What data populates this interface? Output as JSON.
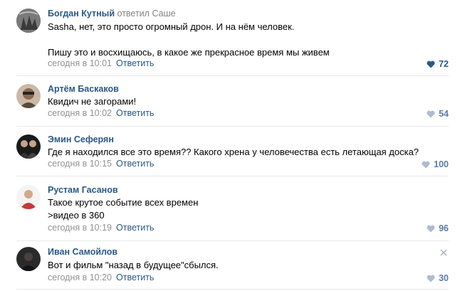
{
  "comments": [
    {
      "author": "Богдан Кутный",
      "reply_word": "ответил",
      "reply_to": "Саше",
      "text": "Sasha, нет, это просто огромный дрон. И на нём человек.\n\nПишу это и восхищаюсь, в какое же прекрасное время мы живем",
      "time": "сегодня в 10:01",
      "reply_label": "Ответить",
      "likes": "72",
      "liked": true
    },
    {
      "author": "Артём Баскаков",
      "text": "Квидич не загорами!",
      "time": "сегодня в 10:02",
      "reply_label": "Ответить",
      "likes": "54",
      "liked": false
    },
    {
      "author": "Эмин Сеферян",
      "text": "Где я находился все это время?? Какого хрена у человечества есть летающая доска?",
      "time": "сегодня в 10:15",
      "reply_label": "Ответить",
      "likes": "100",
      "liked": false
    },
    {
      "author": "Рустам Гасанов",
      "text": "Такое крутое событие всех времен\n>видео в 360",
      "time": "сегодня в 10:19",
      "reply_label": "Ответить",
      "likes": "96",
      "liked": false
    },
    {
      "author": "Иван Самойлов",
      "text": "Вот и фильм \"назад в будущее\"сбылся.",
      "time": "сегодня в 10:20",
      "reply_label": "Ответить",
      "likes": "30",
      "liked": false
    }
  ],
  "colors": {
    "link": "#2a5885",
    "meta": "#939393",
    "like": "#5b7aa8",
    "separator": "#e7e8ec"
  },
  "icons": [
    "heart-icon",
    "close-icon"
  ]
}
